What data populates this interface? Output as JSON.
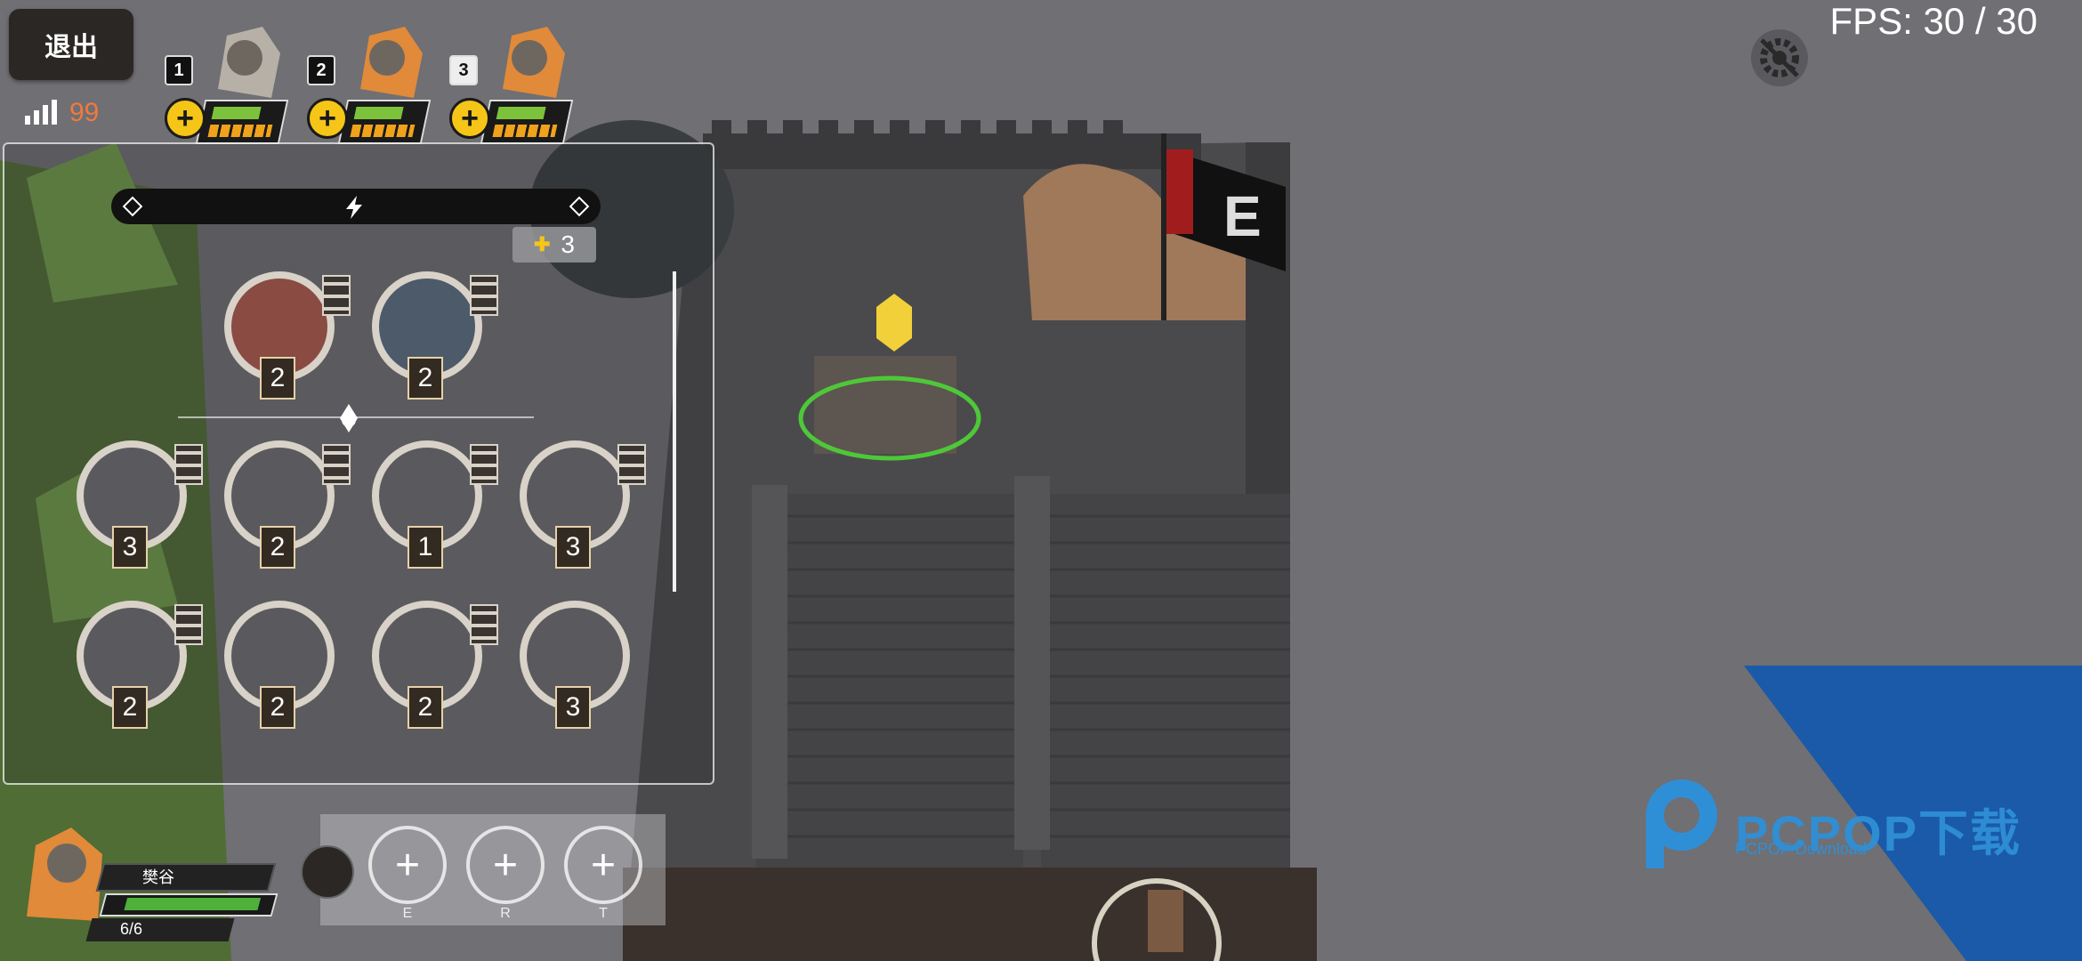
{
  "hud": {
    "exit_label": "退出",
    "ping_value": "99",
    "fps_text": "FPS: 30 / 30"
  },
  "heroes": [
    {
      "slot": "1",
      "hp_fraction": 0.75,
      "selected": false
    },
    {
      "slot": "2",
      "hp_fraction": 0.75,
      "selected": false
    },
    {
      "slot": "3",
      "hp_fraction": 0.75,
      "selected": true
    }
  ],
  "skill_panel": {
    "points_cost": "3",
    "top_row": [
      {
        "name": "skill-reaper",
        "level": "2"
      },
      {
        "name": "skill-charge",
        "level": "2"
      }
    ],
    "rows": [
      [
        {
          "name": "skill-strike",
          "level": "3"
        },
        {
          "name": "skill-swordsman",
          "level": "2"
        },
        {
          "name": "skill-spartan",
          "level": "1"
        },
        {
          "name": "skill-volley",
          "level": "3"
        }
      ],
      [
        {
          "name": "skill-shieldwall",
          "level": "2"
        },
        {
          "name": "skill-brawler",
          "level": "2"
        },
        {
          "name": "skill-whirlwind",
          "level": "2"
        },
        {
          "name": "skill-tackle",
          "level": "3"
        }
      ]
    ]
  },
  "selected_hero": {
    "name": "樊谷",
    "troops": "6/6"
  },
  "abilities": [
    {
      "key": "E"
    },
    {
      "key": "R"
    },
    {
      "key": "T"
    }
  ],
  "watermark": {
    "brand": "PCPOP下载",
    "sub": "PCPOP Download"
  },
  "colors": {
    "accent_yellow": "#f5c518",
    "hp_green": "#7cc23a",
    "ping_orange": "#f07a3c",
    "panel_dark": "#2b2724"
  }
}
